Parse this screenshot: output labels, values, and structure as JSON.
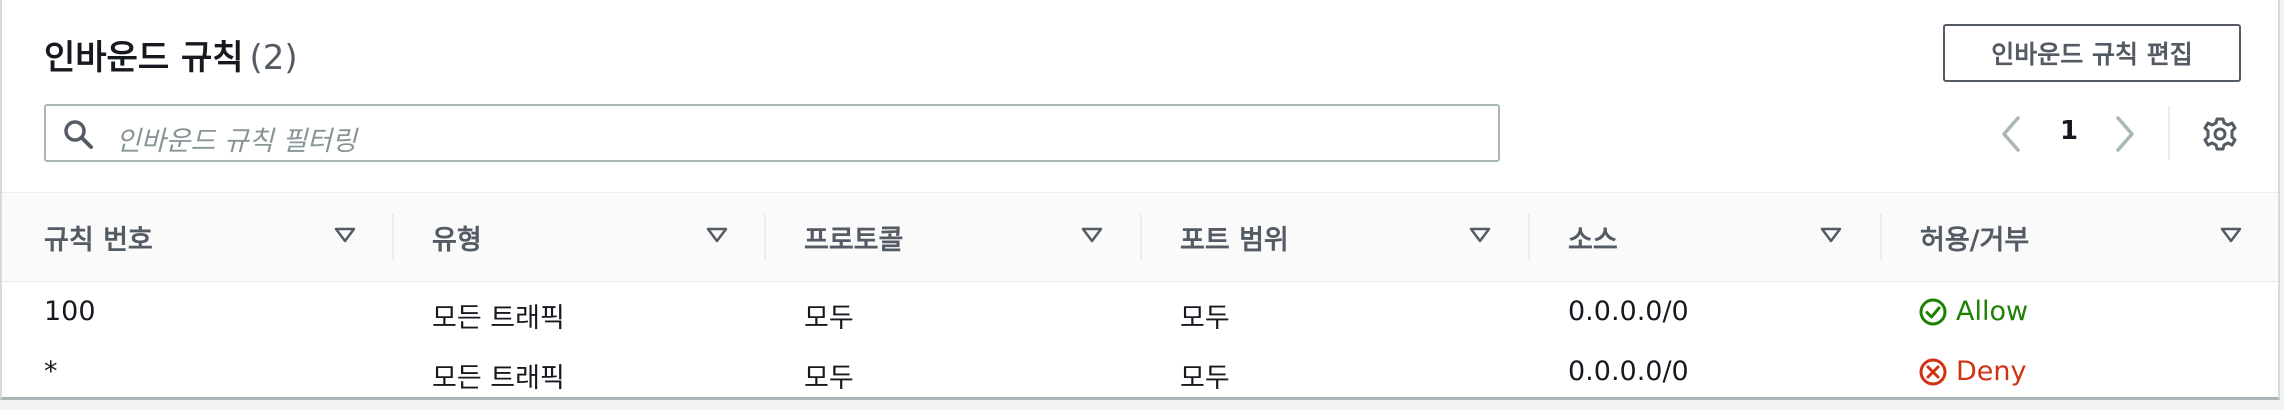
{
  "title": "인바운드 규칙",
  "count": "(2)",
  "edit_button": "인바운드 규칙 편집",
  "search": {
    "placeholder": "인바운드 규칙 필터링"
  },
  "pagination": {
    "current_page": "1"
  },
  "columns": [
    "규칙 번호",
    "유형",
    "프로토콜",
    "포트 범위",
    "소스",
    "허용/거부"
  ],
  "rows": [
    {
      "rule_number": "100",
      "type": "모든 트래픽",
      "protocol": "모두",
      "port_range": "모두",
      "source": "0.0.0.0/0",
      "action": "Allow"
    },
    {
      "rule_number": "*",
      "type": "모든 트래픽",
      "protocol": "모두",
      "port_range": "모두",
      "source": "0.0.0.0/0",
      "action": "Deny"
    }
  ],
  "colors": {
    "allow": "#1d8102",
    "deny": "#d13212",
    "text": "#16191f",
    "muted": "#545b64",
    "border": "#aab7b8"
  },
  "icons": [
    "search-icon",
    "chevron-left-icon",
    "chevron-right-icon",
    "gear-icon",
    "sort-icon",
    "check-circle-icon",
    "x-circle-icon"
  ]
}
